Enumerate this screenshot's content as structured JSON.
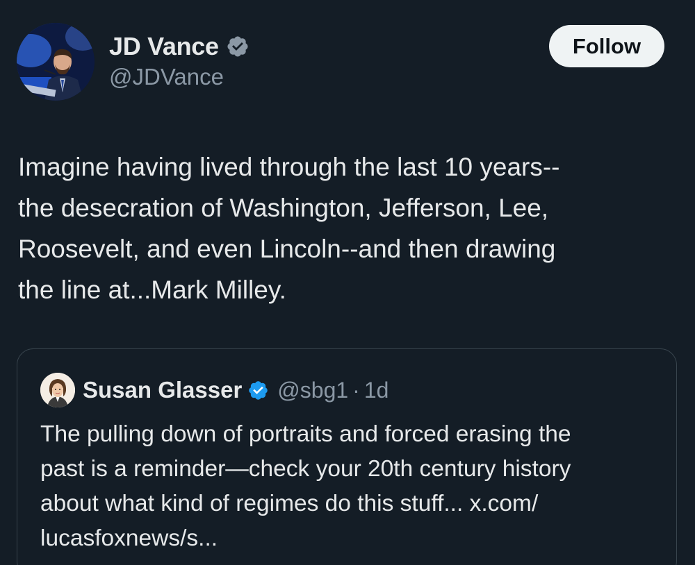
{
  "author": {
    "display_name": "JD Vance",
    "handle": "@JDVance",
    "verified": true,
    "verified_badge_color": "#8b98a5"
  },
  "follow_button": {
    "label": "Follow"
  },
  "tweet": {
    "text": "Imagine having lived through the last 10 years--\nthe desecration of Washington, Jefferson, Lee,\nRoosevelt, and even Lincoln--and then drawing\nthe line at...Mark Milley."
  },
  "quoted_tweet": {
    "display_name": "Susan Glasser",
    "handle": "@sbg1",
    "separator": "·",
    "timestamp": "1d",
    "verified": true,
    "verified_badge_color": "#1d9bf0",
    "text": "The pulling down of portraits and forced erasing the\npast is a reminder—check your 20th century history\nabout what kind of regimes do this stuff... x.com/\nlucasfoxnews/s..."
  },
  "colors": {
    "background": "#141d26",
    "text_primary": "#e7e9ea",
    "text_secondary": "#8b98a5",
    "border": "#38444d",
    "follow_button_bg": "#eff3f4"
  },
  "icons": {
    "author_avatar": "profile-photo",
    "author_verified": "verified-badge-icon",
    "quoted_avatar": "profile-photo",
    "quoted_verified": "verified-badge-icon"
  }
}
